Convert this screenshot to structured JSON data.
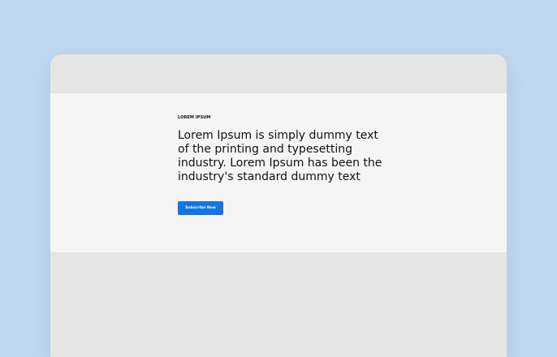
{
  "hero": {
    "eyebrow": "LOREM IPSUM",
    "headline": "Lorem Ipsum is simply dummy text of the printing and typesetting industry. Lorem Ipsum has been the industry's standard dummy text",
    "cta_label": "Subscribe Now"
  },
  "colors": {
    "page_background": "#c0d8ef",
    "window_background": "#e5e5e5",
    "hero_background": "#f5f5f5",
    "accent": "#1475e1"
  }
}
